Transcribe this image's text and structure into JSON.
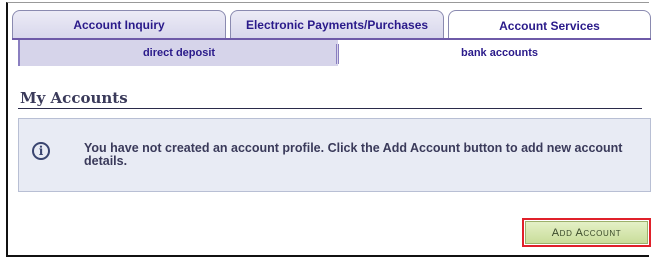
{
  "tabs": [
    {
      "label": "Account Inquiry"
    },
    {
      "label": "Electronic Payments/Purchases"
    },
    {
      "label": "Account Services"
    }
  ],
  "subtabs": [
    {
      "label": "direct deposit"
    },
    {
      "label": "bank accounts"
    }
  ],
  "page": {
    "title": "My Accounts",
    "info_message": "You have not created an account profile.  Click the Add Account button to add new account details."
  },
  "actions": {
    "add_account_label": "Add Account"
  },
  "colors": {
    "tab_text": "#2a1a8a",
    "info_bg": "#e8ebf4",
    "button_highlight": "#e0202a",
    "button_bg": "#d4e6ac"
  },
  "icons": {
    "info": "info-circle-icon"
  }
}
